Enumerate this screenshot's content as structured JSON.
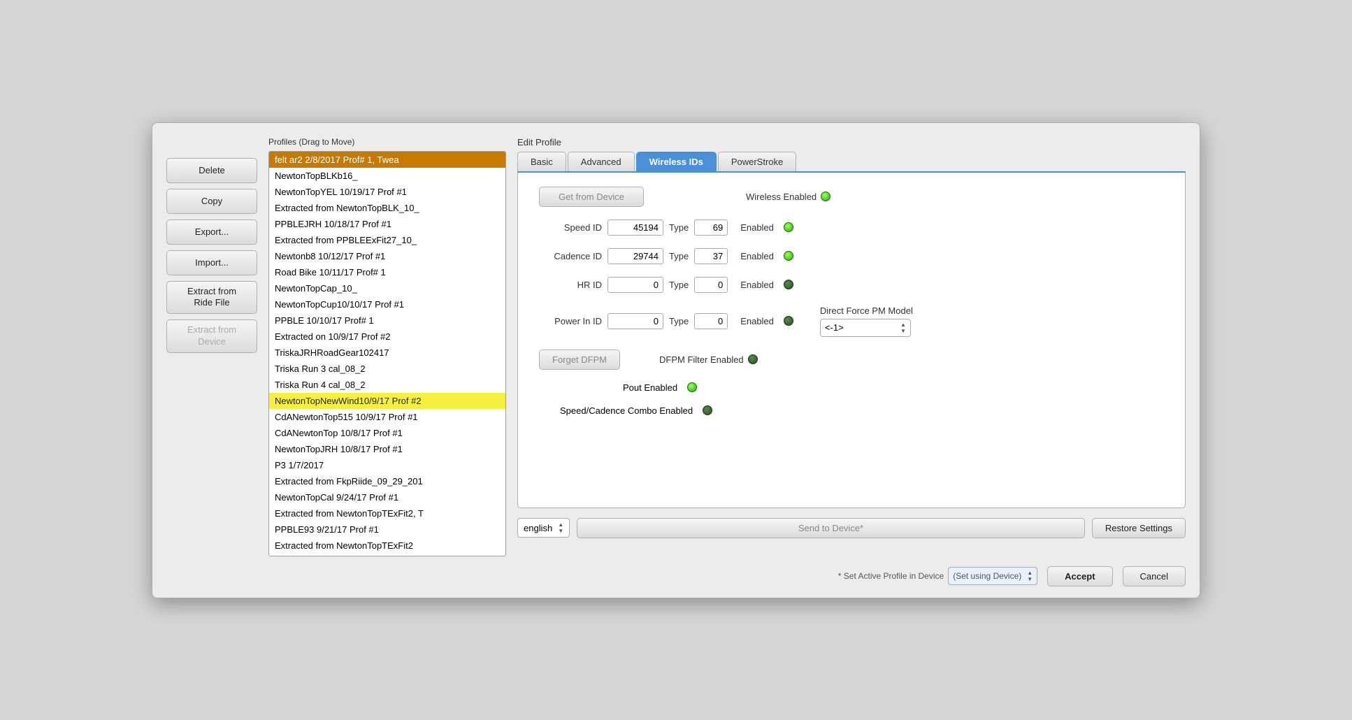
{
  "dialog": {
    "title": "Edit Profile",
    "profiles_label": "Profiles (Drag to Move)",
    "profiles": [
      {
        "text": "felt ar2 2/8/2017 Prof# 1, Twea",
        "state": "selected-orange"
      },
      {
        "text": "NewtonTopBLKb16_",
        "state": "normal"
      },
      {
        "text": "NewtonTopYEL 10/19/17 Prof #1",
        "state": "normal"
      },
      {
        "text": "Extracted from NewtonTopBLK_10_",
        "state": "normal"
      },
      {
        "text": "PPBLEJRH 10/18/17 Prof #1",
        "state": "normal"
      },
      {
        "text": "Extracted from PPBLEExFit27_10_",
        "state": "normal"
      },
      {
        "text": "Newtonb8 10/12/17 Prof #1",
        "state": "normal"
      },
      {
        "text": "Road Bike 10/11/17 Prof# 1",
        "state": "normal"
      },
      {
        "text": "NewtonTopCap_10_",
        "state": "normal"
      },
      {
        "text": "NewtonTopCup10/10/17 Prof #1",
        "state": "normal"
      },
      {
        "text": "PPBLE 10/10/17 Prof# 1",
        "state": "normal"
      },
      {
        "text": "Extracted on 10/9/17 Prof #2",
        "state": "normal"
      },
      {
        "text": "TriskaJRHRoadGear102417",
        "state": "normal"
      },
      {
        "text": "Triska Run 3 cal_08_2",
        "state": "normal"
      },
      {
        "text": "Triska Run 4 cal_08_2",
        "state": "normal"
      },
      {
        "text": "NewtonTopNewWind10/9/17 Prof #2",
        "state": "selected-yellow"
      },
      {
        "text": "CdANewtonTop515 10/9/17 Prof #1",
        "state": "normal"
      },
      {
        "text": "CdANewtonTop 10/8/17 Prof #1",
        "state": "normal"
      },
      {
        "text": "NewtonTopJRH 10/8/17 Prof #1",
        "state": "normal"
      },
      {
        "text": "P3 1/7/2017",
        "state": "normal"
      },
      {
        "text": "Extracted from FkpRiide_09_29_201",
        "state": "normal"
      },
      {
        "text": "NewtonTopCal 9/24/17 Prof #1",
        "state": "normal"
      },
      {
        "text": "Extracted from NewtonTopTExFit2, T",
        "state": "normal"
      },
      {
        "text": "PPBLE93 9/21/17 Prof #1",
        "state": "normal"
      },
      {
        "text": "Extracted from NewtonTopTExFit2",
        "state": "normal"
      }
    ],
    "buttons": {
      "delete": "Delete",
      "copy": "Copy",
      "export": "Export...",
      "import": "Import...",
      "extract_ride": "Extract from\nRide File",
      "extract_device": "Extract from\nDevice"
    },
    "tabs": [
      "Basic",
      "Advanced",
      "Wireless IDs",
      "PowerStroke"
    ],
    "active_tab": "Wireless IDs",
    "wireless_ids": {
      "get_from_device": "Get from Device",
      "wireless_enabled_label": "Wireless Enabled",
      "speed_id_label": "Speed ID",
      "speed_id_value": "45194",
      "speed_type_label": "Type",
      "speed_type_value": "69",
      "speed_enabled_label": "Enabled",
      "cadence_id_label": "Cadence ID",
      "cadence_id_value": "29744",
      "cadence_type_label": "Type",
      "cadence_type_value": "37",
      "cadence_enabled_label": "Enabled",
      "hr_id_label": "HR ID",
      "hr_id_value": "0",
      "hr_type_label": "Type",
      "hr_type_value": "0",
      "hr_enabled_label": "Enabled",
      "power_in_id_label": "Power In ID",
      "power_in_id_value": "0",
      "power_in_type_label": "Type",
      "power_in_type_value": "0",
      "power_in_enabled_label": "Enabled",
      "forget_dfpm": "Forget DFPM",
      "dfpm_filter_label": "DFPM Filter Enabled",
      "direct_force_label": "Direct Force PM Model",
      "direct_force_value": "<-1>",
      "pout_enabled_label": "Pout Enabled",
      "speed_cadence_combo_label": "Speed/Cadence Combo Enabled"
    },
    "bottom": {
      "language": "english",
      "send_to_device": "Send to Device*",
      "restore_settings": "Restore Settings"
    },
    "footer": {
      "note": "* Set Active Profile in Device",
      "device_select": "(Set using Device)",
      "accept": "Accept",
      "cancel": "Cancel"
    }
  }
}
